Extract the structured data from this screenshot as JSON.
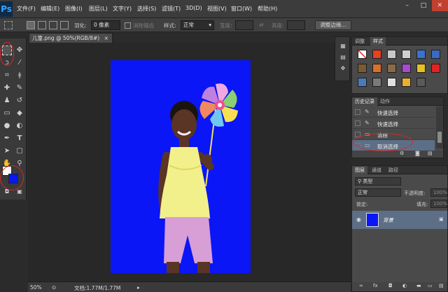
{
  "app": {
    "logo": "Ps",
    "menu": [
      "文件(F)",
      "编辑(E)",
      "图像(I)",
      "图层(L)",
      "文字(Y)",
      "选择(S)",
      "滤镜(T)",
      "3D(D)",
      "视图(V)",
      "窗口(W)",
      "帮助(H)"
    ],
    "window_controls": [
      "–",
      "□",
      "✕"
    ]
  },
  "options": {
    "feather_label": "羽化:",
    "feather_value": "0 像素",
    "antialias_label": "消除锯齿",
    "style_label": "样式:",
    "style_value": "正常",
    "width_label": "宽度:",
    "height_label": "高度:",
    "refine_button": "调整边缘..."
  },
  "document": {
    "tab_title": "儿童.png @ 50%(RGB/8#)",
    "tab_close": "×",
    "canvas_color": "#0a16f5"
  },
  "status": {
    "zoom": "50%",
    "doc_info": "文档:1.77M/1.77M"
  },
  "styles_panel": {
    "tabs": [
      "调整",
      "样式"
    ]
  },
  "history_panel": {
    "tabs": [
      "历史记录",
      "动作"
    ],
    "items": [
      {
        "label": "快速选择",
        "icon": "brush-icon"
      },
      {
        "label": "快速选择",
        "icon": "brush-icon"
      },
      {
        "label": "清除",
        "icon": "doc-icon"
      },
      {
        "label": "取消选择",
        "icon": "doc-icon"
      }
    ]
  },
  "layers_panel": {
    "tabs": [
      "图层",
      "通道",
      "路径"
    ],
    "filter_label": "类型",
    "blend_mode": "正常",
    "opacity_label": "不透明度:",
    "opacity_value": "100%",
    "lock_label": "锁定:",
    "fill_label": "填充:",
    "fill_value": "100%",
    "layer_name": "背景"
  },
  "colors": {
    "foreground": "#ffffff",
    "background": "#0a16f5",
    "annotation": "#e0242a",
    "selected_row": "#5c6f86"
  }
}
